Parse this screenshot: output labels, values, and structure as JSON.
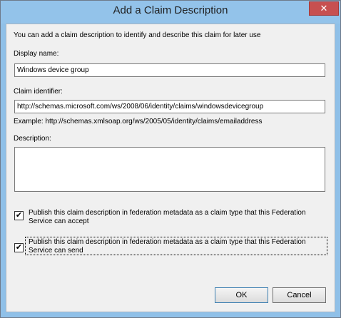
{
  "window": {
    "title": "Add a Claim Description",
    "close_glyph": "✕"
  },
  "intro_text": "You can add a claim description to identify and describe this claim for later use",
  "display_name": {
    "label": "Display name:",
    "value": "Windows device group"
  },
  "claim_identifier": {
    "label": "Claim identifier:",
    "value": "http://schemas.microsoft.com/ws/2008/06/identity/claims/windowsdevicegroup",
    "example": "Example: http://schemas.xmlsoap.org/ws/2005/05/identity/claims/emailaddress"
  },
  "description": {
    "label": "Description:",
    "value": ""
  },
  "checkboxes": [
    {
      "checked": true,
      "glyph": "✔",
      "line1": "Publish this claim description in federation metadata as a claim type that this Federation",
      "line2": "Service can accept"
    },
    {
      "checked": true,
      "glyph": "✔",
      "line1": "Publish this claim description in federation metadata as a claim type that this Federation",
      "line2": "Service can send"
    }
  ],
  "buttons": {
    "ok": "OK",
    "cancel": "Cancel"
  },
  "colors": {
    "title_bar": "#93c3ea",
    "close_button": "#c75050",
    "client_bg": "#f0f0f0",
    "default_button_border": "#3c7fb1"
  }
}
